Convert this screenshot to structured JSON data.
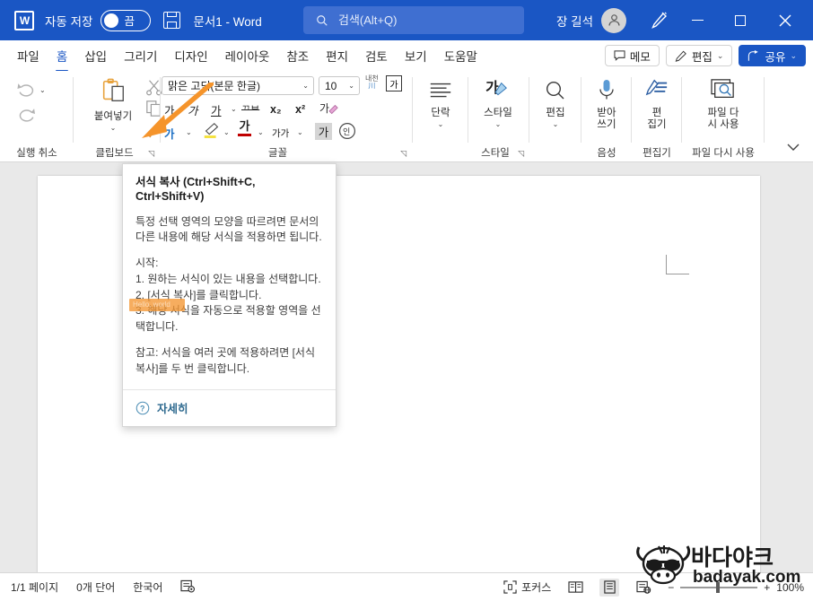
{
  "titlebar": {
    "app_icon": "word-logo-icon",
    "autosave_label": "자동 저장",
    "autosave_state": "끔",
    "save_icon": "save-icon",
    "document_title": "문서1  -  Word",
    "account_name": "장 길석",
    "account_icon": "avatar-person-icon",
    "pen_icon": "pen-annotate-icon",
    "minimize_icon": "minimize-icon",
    "maximize_icon": "maximize-icon",
    "close_icon": "close-icon"
  },
  "search": {
    "icon": "search-icon",
    "placeholder": "검색(Alt+Q)",
    "value": ""
  },
  "tabs": [
    {
      "label": "파일",
      "active": false
    },
    {
      "label": "홈",
      "active": true
    },
    {
      "label": "삽입",
      "active": false
    },
    {
      "label": "그리기",
      "active": false
    },
    {
      "label": "디자인",
      "active": false
    },
    {
      "label": "레이아웃",
      "active": false
    },
    {
      "label": "참조",
      "active": false
    },
    {
      "label": "편지",
      "active": false
    },
    {
      "label": "검토",
      "active": false
    },
    {
      "label": "보기",
      "active": false
    },
    {
      "label": "도움말",
      "active": false
    }
  ],
  "tab_right": {
    "comment_icon": "comment-icon",
    "comment_label": "메모",
    "edit_icon": "pencil-icon",
    "edit_label": "편집",
    "edit_caret": "⌄",
    "share_icon": "share-icon",
    "share_label": "공유",
    "share_caret": "⌄"
  },
  "ribbon": {
    "groups": [
      {
        "name": "undo",
        "label": "실행 취소"
      },
      {
        "name": "clipboard",
        "label": "클립보드"
      },
      {
        "name": "font",
        "label": "글꼴"
      },
      {
        "name": "paragraph",
        "label": "단락"
      },
      {
        "name": "styles",
        "label": "스타일"
      },
      {
        "name": "editing",
        "label": "편집"
      },
      {
        "name": "voice",
        "label": "음성"
      },
      {
        "name": "editor",
        "label": "편집기"
      },
      {
        "name": "reuse",
        "label": "파일 다시 사용"
      }
    ],
    "undo": {
      "undo_icon": "undo-arrow-icon",
      "undo_caret": "⌄",
      "redo_icon": "redo-arrow-icon"
    },
    "clipboard": {
      "paste_icon": "paste-clipboard-icon",
      "paste_label": "붙여넣기",
      "paste_caret": "⌄",
      "cut_icon": "scissors-cut-icon",
      "copy_icon": "copy-icon",
      "format_painter_icon": "format-painter-brush-icon",
      "dialog_launcher": "◹"
    },
    "font": {
      "font_name": "맑은 고딕(본문 한글)",
      "font_size": "10",
      "dropdown_caret": "⌄",
      "grow_font_icon": "increase-font-size-icon",
      "shrink_font_icon": "decrease-font-size-icon",
      "change_case_icon": "change-case-icon",
      "clear_formatting_icon": "clear-formatting-icon",
      "phonetic_guide_label": "내천",
      "phonetic_guide_sub": "川",
      "border_char_icon": "enclose-character-icon",
      "bold_label": "가",
      "italic_label": "가",
      "underline_label": "가",
      "underline_caret": "⌄",
      "strikethrough_label": "ᄁᄇ",
      "subscript_label": "x₂",
      "superscript_label": "x²",
      "text_effects_icon": "text-effects-icon",
      "text_highlight_label": "가",
      "text_highlight_caret": "⌄",
      "font_color_label": "가",
      "font_color_caret": "⌄",
      "char_shading_label": "가가",
      "char_shading_caret": "⌄",
      "char_border_label": "가",
      "circle_char_icon": "circled-character-icon",
      "dialog_launcher": "◹"
    },
    "paragraph": {
      "icon": "paragraph-lines-icon",
      "label": "단락",
      "caret": "⌄"
    },
    "styles": {
      "icon": "styles-brush-icon",
      "label": "스타일",
      "caret": "⌄",
      "dialog_launcher": "◹"
    },
    "editing": {
      "icon": "magnifier-find-icon",
      "label": "편집",
      "caret": "⌄"
    },
    "voice": {
      "icon": "microphone-icon",
      "label_line1": "받아",
      "label_line2": "쓰기"
    },
    "editor": {
      "icon": "editor-pen-icon",
      "label_line1": "편",
      "label_line2": "집기"
    },
    "reuse": {
      "icon": "reuse-files-icon",
      "label_line1": "파일 다",
      "label_line2": "시 사용"
    },
    "collapse_icon": "collapse-ribbon-chevron-icon"
  },
  "tooltip": {
    "title": "서식 복사 (Ctrl+Shift+C, Ctrl+Shift+V)",
    "paragraphs": [
      "특정 선택 영역의 모양을 따르려면 문서의 다른 내용에 해당 서식을 적용하면 됩니다.",
      "시작:\n1. 원하는 서식이 있는 내용을 선택합니다.\n2. [서식 복사]를 클릭합니다.\n3. 해당 서식을 자동으로 적용할 영역을 선택합니다.",
      "참고: 서식을 여러 곳에 적용하려면 [서식 복사]를 두 번 클릭합니다."
    ],
    "more_icon": "help-question-icon",
    "more_label": "자세히"
  },
  "annotation": {
    "arrow_color": "#F5942B",
    "arrow_target": "format-painter-brush-icon",
    "highlight_color": "#F39632",
    "highlight_text": "Hello, world"
  },
  "statusbar": {
    "page_info": "1/1 페이지",
    "word_count": "0개 단어",
    "language": "한국어",
    "proofing_icon": "proofing-status-icon",
    "focus_icon": "focus-mode-icon",
    "focus_label": "포커스",
    "read_view_icon": "read-mode-icon",
    "print_view_icon": "print-layout-icon",
    "web_view_icon": "web-layout-icon",
    "zoom_out": "−",
    "zoom_in": "+",
    "zoom_level": "100%"
  },
  "watermark": {
    "mascot": "bull-mascot-logo",
    "korean_text": "바다야크",
    "domain_text": "badayak.com"
  }
}
